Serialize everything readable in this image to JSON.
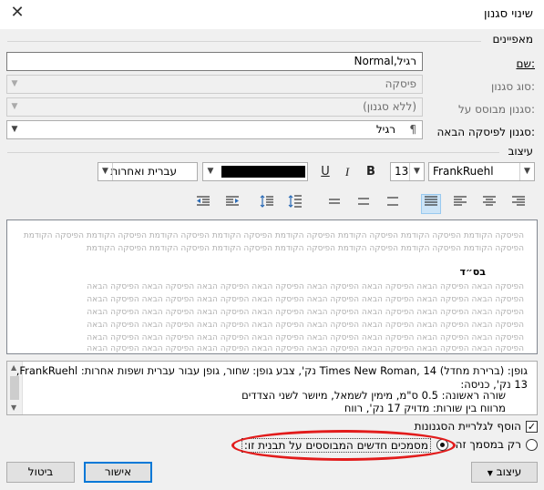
{
  "dialog": {
    "title": "שינוי סגנון",
    "close_glyph": "✕"
  },
  "properties": {
    "group_label": "מאפיינים",
    "name_label": "שם:",
    "name_value": "רגיל,Normal",
    "style_type_label": "סוג סגנון:",
    "style_type_value": "פיסקה",
    "based_on_label": "סגנון מבוסס על:",
    "based_on_value": "(ללא סגנון)",
    "next_style_label": "סגנון לפיסקה הבאה:",
    "next_style_value": "רגיל",
    "next_style_icon": "¶"
  },
  "formatting": {
    "group_label": "עיצוב",
    "font": "FrankRuehl",
    "size": "13",
    "bold": "B",
    "italic": "I",
    "underline": "U",
    "script": "עברית ואחרות",
    "color": "#000000"
  },
  "preview": {
    "prev_line_1": "הפיסקה הקודמת הפיסקה הקודמת הפיסקה הקודמת הפיסקה הקודמת הפיסקה הקודמת הפיסקה הקודמת הפיסקה הקודמת הפיסקה הקודמת",
    "prev_line_2": "הפיסקה הקודמת הפיסקה הקודמת הפיסקה הקודמת הפיסקה הקודמת הפיסקה הקודמת הפיסקה הקודמת הפיסקה הקודמת",
    "sample": "בס״ד",
    "next_line_1": "הפיסקה הבאה הפיסקה הבאה הפיסקה הבאה הפיסקה הבאה הפיסקה הבאה הפיסקה הבאה הפיסקה הבאה הפיסקה הבאה",
    "next_line_2": "הפיסקה הבאה הפיסקה הבאה הפיסקה הבאה הפיסקה הבאה הפיסקה הבאה הפיסקה הבאה הפיסקה הבאה הפיסקה הבאה",
    "next_line_3": "הפיסקה הבאה הפיסקה הבאה הפיסקה הבאה הפיסקה הבאה הפיסקה הבאה הפיסקה הבאה הפיסקה הבאה הפיסקה הבאה",
    "next_line_4": "הפיסקה הבאה הפיסקה הבאה הפיסקה הבאה הפיסקה הבאה הפיסקה הבאה הפיסקה הבאה הפיסקה הבאה הפיסקה הבאה",
    "next_line_5": "הפיסקה הבאה הפיסקה הבאה הפיסקה הבאה הפיסקה הבאה הפיסקה הבאה הפיסקה הבאה הפיסקה הבאה הפיסקה הבאה",
    "next_line_6": "הפיסקה הבאה הפיסקה הבאה הפיסקה הבאה הפיסקה הבאה הפיסקה הבאה הפיסקה הבאה הפיסקה הבאה הפיסקה הבאה"
  },
  "description": {
    "line_1": "גופן: (ברירת מחדל) Times New Roman, 14 נק', צבע גופן: שחור, גופן עבור עברית ושפות אחרות: FrankRuehl,",
    "line_2": "13 נק', כניסה:",
    "line_3": "שורה ראשונה:  0.5  ס\"מ, מימין לשמאל, מיושר לשני הצדדים",
    "line_4": "מרווח בין שורות:  מדויק 17  נק', רווח"
  },
  "options": {
    "add_to_gallery": "הוסף לגלריית הסגנונות",
    "add_to_gallery_checked": true,
    "only_this_doc": "רק במסמך זה",
    "new_docs_template": "מסמכים חדשים המבוססים על תבנית זו:"
  },
  "buttons": {
    "format": "עיצוב",
    "ok": "אישור",
    "cancel": "ביטול"
  },
  "colors": {
    "accent": "#0078d7",
    "annotation": "#e21b1b"
  }
}
